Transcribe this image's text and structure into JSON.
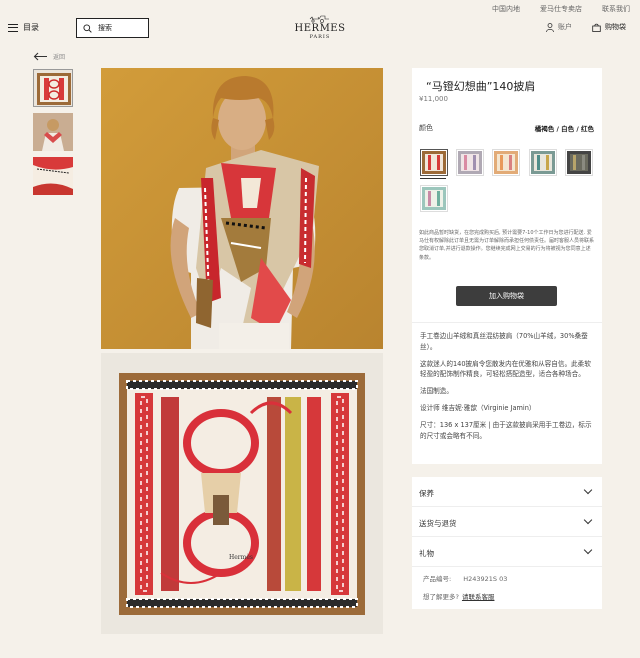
{
  "header": {
    "top_links": [
      "中国内地",
      "爱马仕专卖店",
      "联系我们"
    ],
    "menu_label": "目录",
    "search_placeholder": "搜索",
    "logo_brand": "HERMES",
    "logo_city": "PARIS",
    "account_label": "账户",
    "bag_label": "购物袋"
  },
  "nav": {
    "back_label": "返回"
  },
  "product": {
    "title": "“马镫幻想曲”140披肩",
    "price": "¥11,000",
    "color_label": "颜色",
    "color_value": "橘褐色 / 白色 / 红色",
    "notice": "如此商品暂时缺货，在您完成购买后, 预计需要7-10个工作日为您进行配送. 爱马仕有权解除此订单且无需为订单解除而承担任何债责任。届时客服人员将联系您取消订单,并进行退款操作。您继续完成网上交易的行为将被视为您同意上述条款。",
    "add_to_cart": "加入购物袋",
    "description": [
      "手工卷边山羊绒和真丝混纺披肩（70%山羊绒，30%桑蚕丝）。",
      "这款迷人的140披肩令您散发内在优雅和从容自信。此柔软轻盈的配饰制作精良，可轻松搭配造型，适合各种场合。",
      "法国制造。",
      "设计师 维吉妮·雅歆（Virginie Jamin）",
      "尺寸：136 x 137厘米 | 由于这款披肩采用手工卷边，标示的尺寸或会略有不同。"
    ]
  },
  "accordion": [
    "保养",
    "送货与退货",
    "礼物"
  ],
  "footer": {
    "code_label": "产品编号:",
    "code_value": "H243921S 03",
    "contact_text": "想了解更多?",
    "contact_link": "请联系客服"
  }
}
